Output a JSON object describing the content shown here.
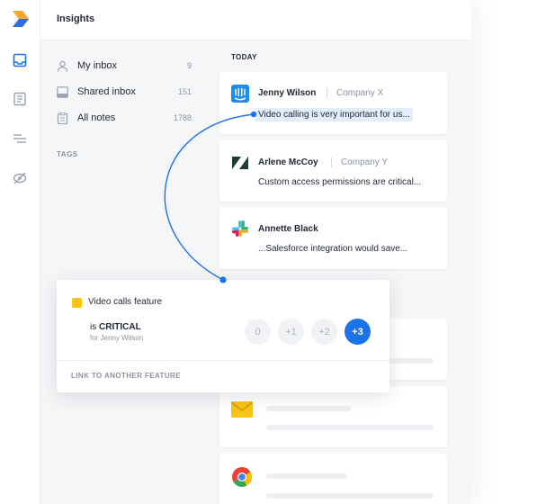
{
  "header": {
    "title": "Insights"
  },
  "nav": {
    "items": [
      {
        "label": "My inbox",
        "count": "9",
        "icon": "inbox-icon"
      },
      {
        "label": "Shared inbox",
        "count": "151",
        "icon": "shared-inbox-icon"
      },
      {
        "label": "All notes",
        "count": "1788",
        "icon": "notes-icon"
      }
    ],
    "tags_label": "TAGS"
  },
  "rail": {
    "icons": [
      "inbox-icon",
      "document-icon",
      "list-icon",
      "eye-off-icon"
    ]
  },
  "feed": {
    "section_label": "TODAY",
    "cards": [
      {
        "name": "Jenny Wilson",
        "company": "Company X",
        "text": "Video calling is very important for us...",
        "logo": "intercom-logo-icon"
      },
      {
        "name": "Arlene McCoy",
        "company": "Company Y",
        "text": "Custom access permissions are critical...",
        "logo": "zendesk-logo-icon"
      },
      {
        "name": "Annette Black",
        "company": "",
        "text": "...Salesforce integration would save...",
        "logo": "slack-logo-icon"
      }
    ]
  },
  "popup": {
    "feature_title": "Video calls feature",
    "is_label": "is",
    "importance": "CRITICAL",
    "for_label": "for Jenny Wilson",
    "scores": [
      "0",
      "+1",
      "+2",
      "+3"
    ],
    "selected_score": "+3",
    "link_label": "LINK TO ANOTHER FEATURE"
  },
  "colors": {
    "accent": "#1a73e8",
    "feature_square": "#f7c418",
    "background": "#f5f6f8"
  }
}
